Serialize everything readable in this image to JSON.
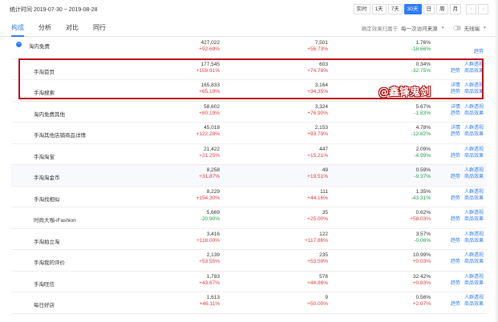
{
  "header": {
    "date_range": "统计时间 2019-07-30 ~ 2019-08-28",
    "periods": [
      "实时",
      "1天",
      "7天",
      "30天",
      "日",
      "周",
      "月"
    ],
    "active_period": "30天",
    "prev_arrow": "‹",
    "next_arrow": "›"
  },
  "tabs": {
    "items": [
      "构成",
      "分析",
      "对比",
      "同行"
    ],
    "active": "构成"
  },
  "tools": {
    "attribution_label": "确定效果归属于",
    "attribution_value": "每一次访问来源",
    "noise_label": "无线端"
  },
  "rows": [
    {
      "name": "淘内免费",
      "v1": "427,022",
      "c1": "+92.69%",
      "v2": "7,501",
      "c2": "+56.73%",
      "v3": "1.76%",
      "c3": "-18.66%",
      "link1": [],
      "link2": [
        "趋势"
      ],
      "top": true
    },
    {
      "name": "手淘首页",
      "v1": "177,545",
      "c1": "+159.91%",
      "v2": "603",
      "c2": "+74.78%",
      "v3": "0.34%",
      "c3": "-32.75%",
      "link1": [
        "人群透视"
      ],
      "link2": [
        "趋势",
        "商品效果"
      ]
    },
    {
      "name": "手淘搜索",
      "v1": "165,833",
      "c1": "+65.19%",
      "v2": "3,164",
      "c2": "+34.35%",
      "v3": "",
      "c3": "",
      "link1": [
        "详情",
        "人群透视"
      ],
      "link2": [
        "趋势",
        "商品效果"
      ]
    },
    {
      "name": "淘内免费其他",
      "v1": "58,602",
      "c1": "+80.19%",
      "v2": "3,324",
      "c2": "+76.90%",
      "v3": "5.67%",
      "c3": "-1.83%",
      "link1": [
        "详情",
        "人群透视"
      ],
      "link2": [
        "趋势",
        "商品效果"
      ]
    },
    {
      "name": "手淘其他店铺商品详情",
      "v1": "45,018",
      "c1": "+122.28%",
      "v2": "2,153",
      "c2": "+93.79%",
      "v3": "4.78%",
      "c3": "-12.82%",
      "link1": [
        "详情",
        "人群透视"
      ],
      "link2": [
        "趋势",
        "商品效果"
      ]
    },
    {
      "name": "手淘淘宝",
      "v1": "21,422",
      "c1": "+21.25%",
      "v2": "447",
      "c2": "+15.21%",
      "v3": "2.09%",
      "c3": "-4.99%",
      "link1": [
        "人群透视"
      ],
      "link2": [
        "趋势",
        "商品效果"
      ]
    },
    {
      "name": "手淘淘金币",
      "v1": "8,258",
      "c1": "+31.87%",
      "v2": "49",
      "c2": "+19.51%",
      "v3": "0.59%",
      "c3": "-9.37%",
      "link1": [
        "人群透视"
      ],
      "link2": [
        "趋势",
        "商品效果"
      ]
    },
    {
      "name": "手淘找相似",
      "v1": "8,229",
      "c1": "+154.30%",
      "v2": "111",
      "c2": "+44.16%",
      "v3": "1.35%",
      "c3": "-43.31%",
      "link1": [
        "人群透视"
      ],
      "link2": [
        "趋势",
        "商品效果"
      ]
    },
    {
      "name": "时尚大咖-iFashion",
      "v1": "5,669",
      "c1": "-20.90%",
      "v2": "35",
      "c2": "+25.00%",
      "v3": "0.62%",
      "c3": "+58.03%",
      "link1": [
        "人群透视"
      ],
      "link2": [
        "趋势",
        "商品效果"
      ]
    },
    {
      "name": "手淘拍立淘",
      "v1": "3,416",
      "c1": "+118.00%",
      "v2": "122",
      "c2": "+117.86%",
      "v3": "3.57%",
      "c3": "-0.06%",
      "link1": [
        "人群透视"
      ],
      "link2": [
        "趋势",
        "商品效果"
      ]
    },
    {
      "name": "手淘我的评价",
      "v1": "2,139",
      "c1": "+53.55%",
      "v2": "235",
      "c2": "+53.59%",
      "v3": "10.99%",
      "c3": "+0.03%",
      "link1": [
        "人群透视"
      ],
      "link2": [
        "趋势",
        "商品效果"
      ]
    },
    {
      "name": "手淘旺信",
      "v1": "1,783",
      "c1": "+43.67%",
      "v2": "578",
      "c2": "+44.86%",
      "v3": "32.42%",
      "c3": "+0.83%",
      "link1": [
        "人群透视"
      ],
      "link2": [
        "趋势",
        "商品效果"
      ]
    },
    {
      "name": "每日好店",
      "v1": "1,613",
      "c1": "+46.11%",
      "v2": "9",
      "c2": "+50.00%",
      "v3": "0.56%",
      "c3": "+2.67%",
      "link1": [
        "人群透视"
      ],
      "link2": [
        "趋势",
        "商品效果"
      ]
    }
  ],
  "watermark": "@鑫锋鬼剑",
  "colors": {
    "accent": "#2f7cf6",
    "up": "#e6393e",
    "down": "#1ba34b",
    "highlight": "#b90d1d"
  }
}
